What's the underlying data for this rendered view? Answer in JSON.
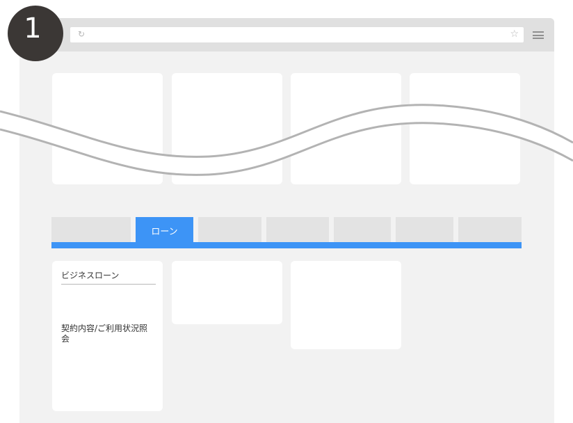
{
  "step": {
    "number": "1"
  },
  "browser": {
    "reload_icon": "reload-icon",
    "bookmark_icon": "star-icon",
    "menu_icon": "hamburger-menu-icon"
  },
  "nav": {
    "tabs": [
      "",
      "ローン",
      "",
      "",
      "",
      "",
      ""
    ],
    "active_tab": "ローン"
  },
  "content": {
    "loan_card": {
      "title": "ビジネスローン",
      "link": "契約内容/ご利用状況照会"
    }
  },
  "colors": {
    "accent": "#3d94f6",
    "page_background": "#f2f2f2",
    "toolbar": "#e0e0e0",
    "badge": "#3b3735"
  }
}
